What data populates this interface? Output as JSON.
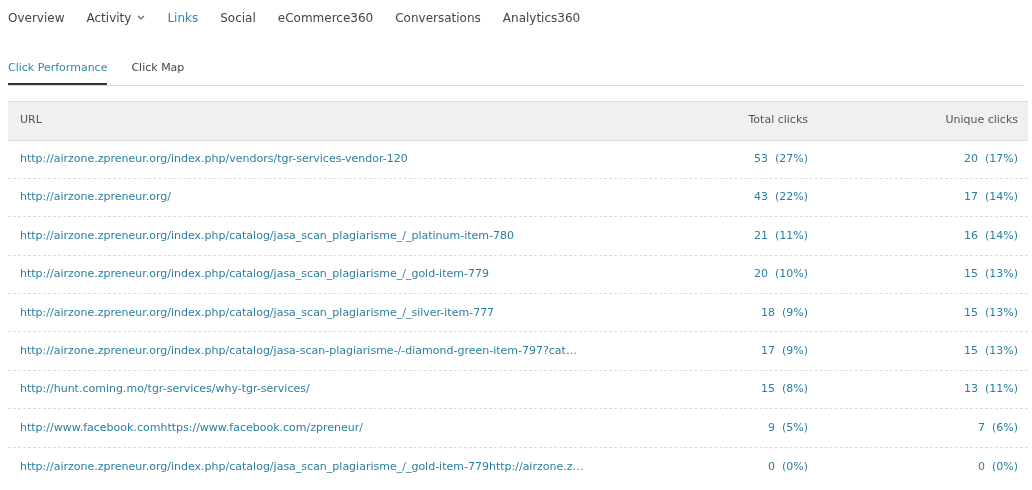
{
  "nav": [
    {
      "label": "Overview",
      "selected": false,
      "dropdown": false
    },
    {
      "label": "Activity",
      "selected": false,
      "dropdown": true
    },
    {
      "label": "Links",
      "selected": true,
      "dropdown": false
    },
    {
      "label": "Social",
      "selected": false,
      "dropdown": false
    },
    {
      "label": "eCommerce360",
      "selected": false,
      "dropdown": false
    },
    {
      "label": "Conversations",
      "selected": false,
      "dropdown": false
    },
    {
      "label": "Analytics360",
      "selected": false,
      "dropdown": false
    }
  ],
  "subtabs": [
    {
      "label": "Click Performance",
      "selected": true
    },
    {
      "label": "Click Map",
      "selected": false
    }
  ],
  "table": {
    "columns": [
      "URL",
      "Total clicks",
      "Unique clicks"
    ],
    "rows": [
      {
        "url": "http://airzone.zpreneur.org/index.php/vendors/tgr-services-vendor-120",
        "total": "53  (27%)",
        "unique": "20  (17%)"
      },
      {
        "url": "http://airzone.zpreneur.org/",
        "total": "43  (22%)",
        "unique": "17  (14%)"
      },
      {
        "url": "http://airzone.zpreneur.org/index.php/catalog/jasa_scan_plagiarisme_/_platinum-item-780",
        "total": "21  (11%)",
        "unique": "16  (14%)"
      },
      {
        "url": "http://airzone.zpreneur.org/index.php/catalog/jasa_scan_plagiarisme_/_gold-item-779",
        "total": "20  (10%)",
        "unique": "15  (13%)"
      },
      {
        "url": "http://airzone.zpreneur.org/index.php/catalog/jasa_scan_plagiarisme_/_silver-item-777",
        "total": "18  (9%)",
        "unique": "15  (13%)"
      },
      {
        "url": "http://airzone.zpreneur.org/index.php/catalog/jasa-scan-plagiarisme-/-diamond-green-item-797?cat…",
        "total": "17  (9%)",
        "unique": "15  (13%)"
      },
      {
        "url": "http://hunt.coming.mo/tgr-services/why-tgr-services/",
        "total": "15  (8%)",
        "unique": "13  (11%)"
      },
      {
        "url": "http://www.facebook.comhttps://www.facebook.com/zpreneur/",
        "total": "9  (5%)",
        "unique": "7  (6%)"
      },
      {
        "url": "http://airzone.zpreneur.org/index.php/catalog/jasa_scan_plagiarisme_/_gold-item-779http://airzone.z…",
        "total": "0  (0%)",
        "unique": "0  (0%)"
      }
    ]
  }
}
